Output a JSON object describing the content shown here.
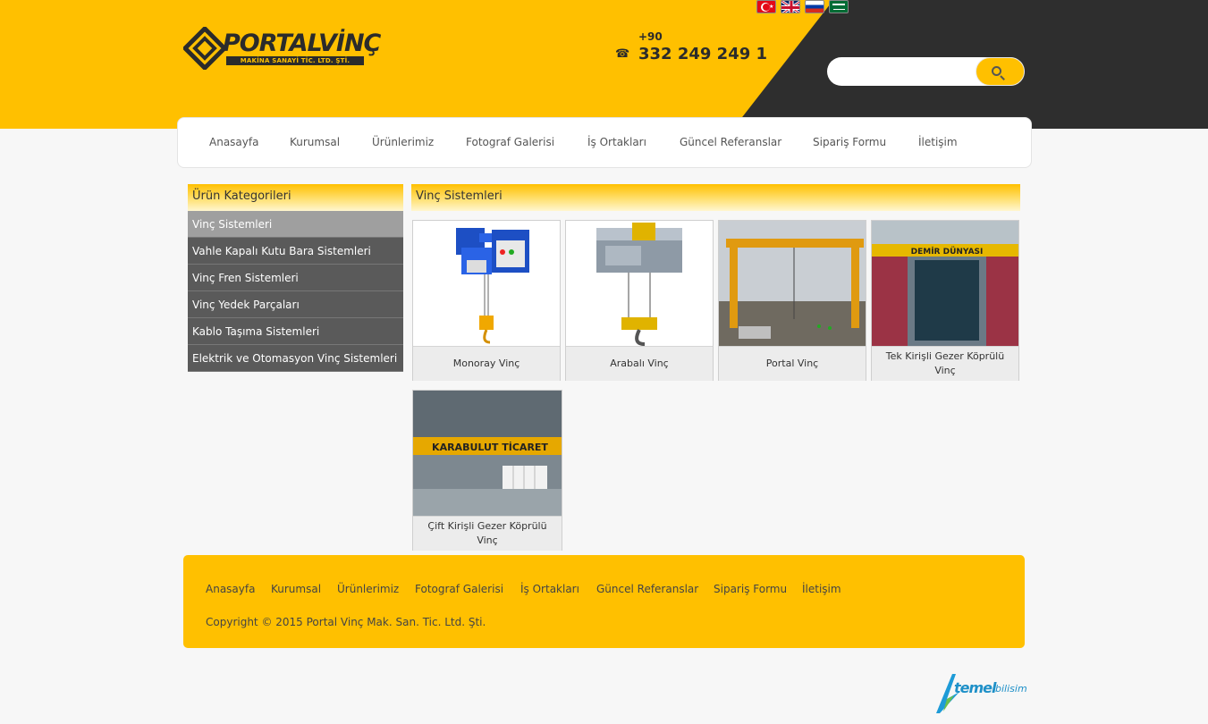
{
  "brand": {
    "name": "PORTALVİNÇ",
    "tagline": "MAKİNA SANAYİ TİC. LTD. ŞTİ."
  },
  "phone": {
    "prefix": "+90",
    "number": "332 249 249 1"
  },
  "languages": [
    {
      "name": "Türkçe",
      "icon": "flag-tr-icon"
    },
    {
      "name": "English",
      "icon": "flag-gb-icon"
    },
    {
      "name": "Русский",
      "icon": "flag-ru-icon"
    },
    {
      "name": "العربية",
      "icon": "flag-sa-icon"
    }
  ],
  "search": {
    "placeholder": "",
    "value": "",
    "icon": "search-icon"
  },
  "nav": {
    "items": [
      "Anasayfa",
      "Kurumsal",
      "Ürünlerimiz",
      "Fotograf Galerisi",
      "İş Ortakları",
      "Güncel Referanslar",
      "Sipariş Formu",
      "İletişim"
    ]
  },
  "sidebar": {
    "title": "Ürün Kategorileri",
    "items": [
      "Vinç Sistemleri",
      "Vahle Kapalı Kutu Bara Sistemleri",
      "Vinç Fren Sistemleri",
      "Vinç Yedek Parçaları",
      "Kablo Taşıma Sistemleri",
      "Elektrik ve Otomasyon Vinç Sistemleri"
    ],
    "active_index": 0
  },
  "main": {
    "title": "Vinç Sistemleri",
    "products": [
      "Monoray Vinç",
      "Arabalı Vinç",
      "Portal Vinç",
      "Tek Kirişli Gezer Köprülü Vinç",
      "Çift Kirişli Gezer Köprülü Vinç"
    ],
    "product_banner_texts": [
      "DEMİR DÜNYASI",
      "KARABULUT TİCARET"
    ]
  },
  "footer": {
    "nav": [
      "Anasayfa",
      "Kurumsal",
      "Ürünlerimiz",
      "Fotograf Galerisi",
      "İş Ortakları",
      "Güncel Referanslar",
      "Sipariş Formu",
      "İletişim"
    ],
    "copyright": "Copyright © 2015 Portal Vinç Mak. San. Tic. Ltd. Şti."
  },
  "developer": {
    "name": "temel",
    "suffix": "bilisim"
  },
  "colors": {
    "accent": "#ffc000",
    "dark": "#2e2e2e",
    "sidebar": "#5a5a5a",
    "sidebar_active": "#9f9f9f"
  }
}
